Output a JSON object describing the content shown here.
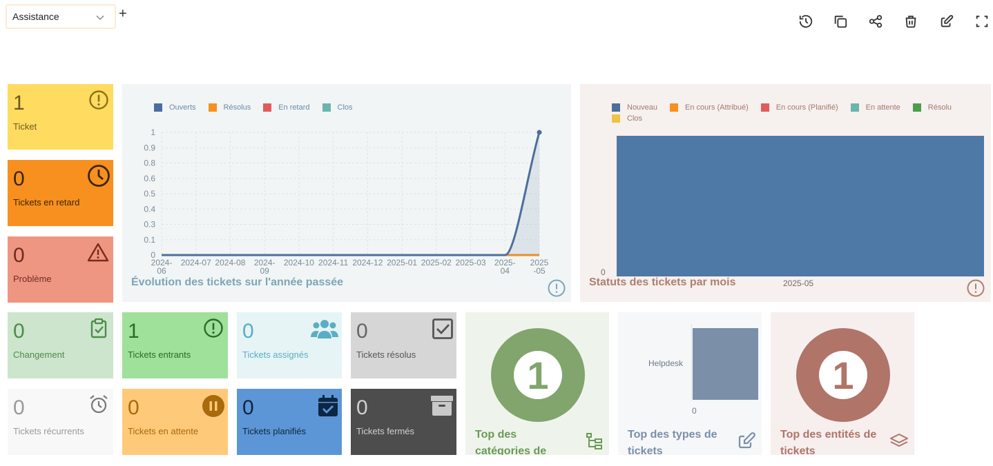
{
  "toolbar": {
    "dashboard_select": "Assistance",
    "add_label": "+",
    "icons": [
      "history-icon",
      "clone-icon",
      "share-icon",
      "trash-icon",
      "edit-icon",
      "fullscreen-icon"
    ]
  },
  "cards": {
    "ticket": {
      "value": "1",
      "label": "Ticket",
      "color": "#ffdb60"
    },
    "late": {
      "value": "0",
      "label": "Tickets en retard",
      "color": "#f7901e"
    },
    "problem": {
      "value": "0",
      "label": "Problème",
      "color": "#ef9682"
    },
    "change": {
      "value": "0",
      "label": "Changement",
      "color": "#cce5cc"
    },
    "incoming": {
      "value": "1",
      "label": "Tickets entrants",
      "color": "#9fe09a"
    },
    "assigned": {
      "value": "0",
      "label": "Tickets assignés",
      "color": "#e6f4f6"
    },
    "solved": {
      "value": "0",
      "label": "Tickets résolus",
      "color": "#d6d6d6"
    },
    "recurrent": {
      "value": "0",
      "label": "Tickets récurrents",
      "color": "#f8f8f8"
    },
    "waiting": {
      "value": "0",
      "label": "Tickets en attente",
      "color": "#ffc97a"
    },
    "planned": {
      "value": "0",
      "label": "Tickets planifiés",
      "color": "#5d96d6"
    },
    "closed": {
      "value": "0",
      "label": "Tickets fermés",
      "color": "#4d4d4d"
    }
  },
  "evolution": {
    "title": "Évolution des tickets sur l'année passée",
    "legend": [
      "Ouverts",
      "Résolus",
      "En retard",
      "Clos"
    ],
    "legend_colors": [
      "#4c6e9c",
      "#f7901e",
      "#e05c5c",
      "#6cb4ae"
    ],
    "y_ticks": [
      "0",
      "0.1",
      "0.3",
      "0.4",
      "0.5",
      "0.6",
      "0.8",
      "0.9",
      "1"
    ],
    "x_labels": [
      [
        "2024-",
        "06"
      ],
      [
        "2024-07"
      ],
      [
        "2024-08"
      ],
      [
        "2024-",
        "09"
      ],
      [
        "2024-10"
      ],
      [
        "2024-11"
      ],
      [
        "2024-12"
      ],
      [
        "2025-01"
      ],
      [
        "2025-02"
      ],
      [
        "2025-03"
      ],
      [
        "2025-",
        "04"
      ],
      [
        "2025",
        "-05"
      ]
    ]
  },
  "status": {
    "title": "Statuts des tickets par mois",
    "legend": [
      "Nouveau",
      "En cours (Attribué)",
      "En cours (Planifié)",
      "En attente",
      "Résolu",
      "Clos"
    ],
    "legend_colors": [
      "#4c6e9c",
      "#f7901e",
      "#e05c5c",
      "#6cb4ae",
      "#4c9c4c",
      "#eec543"
    ],
    "y_label": "0",
    "x_label": "2025-05"
  },
  "top_categories": {
    "value": "1",
    "title_l1": "Top des",
    "title_l2": "catégories de"
  },
  "top_types": {
    "title_l1": "Top des types de",
    "title_l2": "tickets",
    "bar_label": "Helpdesk",
    "axis_zero": "0"
  },
  "top_entities": {
    "value": "1",
    "title_l1": "Top des entités de",
    "title_l2": "tickets"
  },
  "chart_data": [
    {
      "type": "line",
      "title": "Évolution des tickets sur l'année passée",
      "categories": [
        "2024-06",
        "2024-07",
        "2024-08",
        "2024-09",
        "2024-10",
        "2024-11",
        "2024-12",
        "2025-01",
        "2025-02",
        "2025-03",
        "2025-04",
        "2025-05"
      ],
      "series": [
        {
          "name": "Ouverts",
          "values": [
            0,
            0,
            0,
            0,
            0,
            0,
            0,
            0,
            0,
            0,
            0,
            1
          ]
        },
        {
          "name": "Résolus",
          "values": [
            0,
            0,
            0,
            0,
            0,
            0,
            0,
            0,
            0,
            0,
            0,
            0
          ]
        },
        {
          "name": "En retard",
          "values": [
            0,
            0,
            0,
            0,
            0,
            0,
            0,
            0,
            0,
            0,
            0,
            0
          ]
        },
        {
          "name": "Clos",
          "values": [
            0,
            0,
            0,
            0,
            0,
            0,
            0,
            0,
            0,
            0,
            0,
            0
          ]
        }
      ],
      "ylim": [
        0,
        1
      ],
      "legend": "top-left",
      "grid": true
    },
    {
      "type": "bar",
      "title": "Statuts des tickets par mois",
      "categories": [
        "2025-05"
      ],
      "series": [
        {
          "name": "Nouveau",
          "values": [
            1
          ]
        }
      ],
      "legend": "top"
    },
    {
      "type": "bar",
      "title": "Top des types de tickets",
      "categories": [
        "Helpdesk"
      ],
      "values": [
        1
      ]
    }
  ]
}
